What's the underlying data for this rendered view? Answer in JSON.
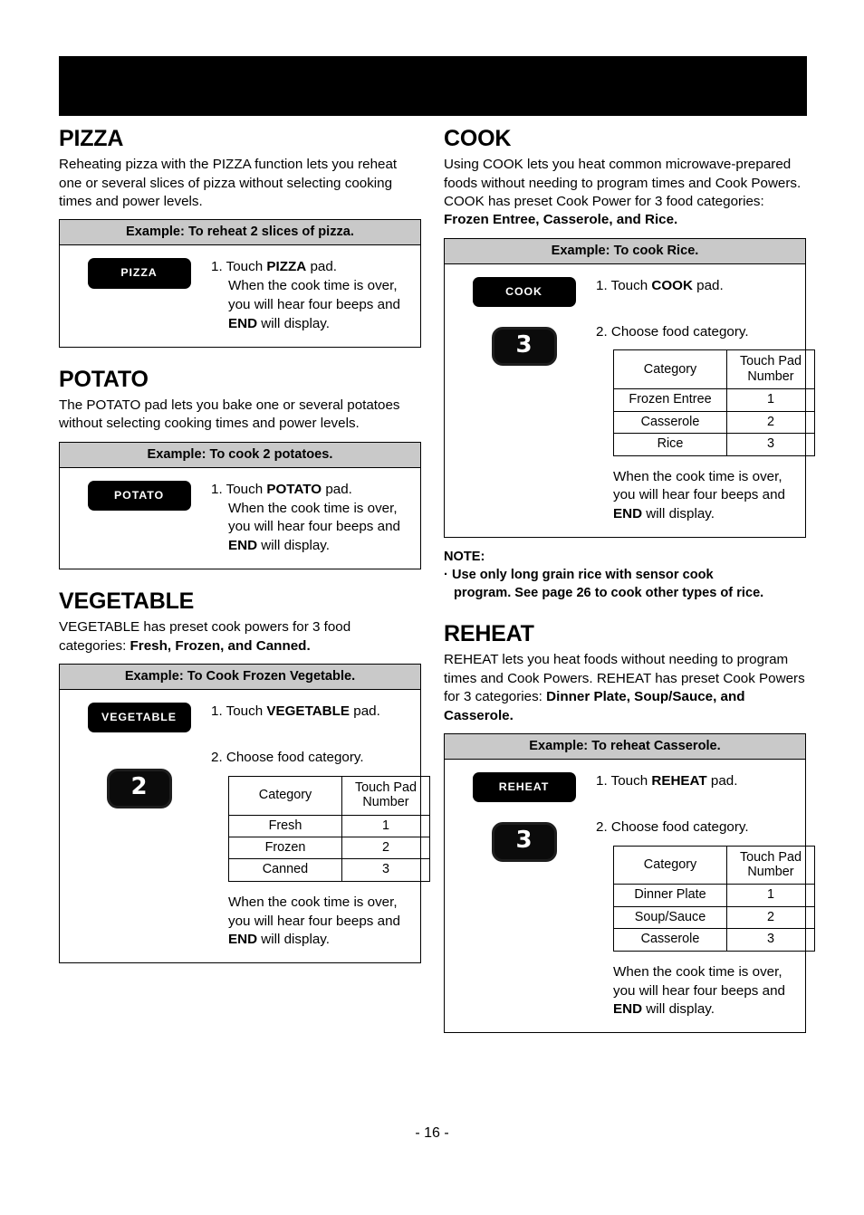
{
  "page": {
    "number_label": "- 16 -",
    "banner_color": "#000000",
    "header_fill": "#c9c9c9"
  },
  "left_column": {
    "pizza": {
      "title": "PIZZA",
      "body": "Reheating pizza with the PIZZA function lets you reheat one or several slices of pizza without selecting cooking times and power levels.",
      "example_header": "Example: To reheat 2 slices of pizza.",
      "pad_label": "PIZZA",
      "step1_prefix": "1. Touch ",
      "step1_strong": "PIZZA",
      "step1_suffix": " pad.",
      "step1_line2": "When the cook time is over,",
      "step1_line3": "you will hear four beeps and",
      "step1_line4_strong": "END",
      "step1_line4_suffix": " will display."
    },
    "potato": {
      "title": "POTATO",
      "body": "The POTATO pad lets you bake one or several potatoes without selecting cooking times and power levels.",
      "example_header": "Example: To cook 2 potatoes.",
      "pad_label": "POTATO",
      "step1_prefix": "1. Touch ",
      "step1_strong": "POTATO",
      "step1_suffix": " pad.",
      "step1_line2": "When the cook time is over,",
      "step1_line3": "you will hear four beeps and",
      "step1_line4_strong": "END",
      "step1_line4_suffix": " will display."
    },
    "vegetable": {
      "title": "VEGETABLE",
      "body_plain": "VEGETABLE has preset cook powers for 3 food categories: ",
      "body_strong": "Fresh, Frozen, and Canned.",
      "example_header": "Example: To Cook Frozen Vegetable.",
      "pad_label": "VEGETABLE",
      "numpad_label": "2",
      "step1_prefix": "1. Touch ",
      "step1_strong": "VEGETABLE",
      "step1_suffix": " pad.",
      "step2": "2. Choose food category.",
      "table": {
        "header": [
          "Category",
          "Touch Pad Number"
        ],
        "header_col2_line1": "Touch Pad",
        "header_col2_line2": "Number",
        "rows": [
          [
            "Fresh",
            "1"
          ],
          [
            "Frozen",
            "2"
          ],
          [
            "Canned",
            "3"
          ]
        ]
      },
      "closing_line1": "When the cook time is over,",
      "closing_line2": "you will hear four beeps and",
      "closing_line3_strong": "END",
      "closing_line3_suffix": " will display."
    }
  },
  "right_column": {
    "cook": {
      "title": "COOK",
      "body_plain": "Using COOK lets you heat common microwave-prepared foods without needing to program times and Cook Powers. COOK has preset Cook Power for 3 food categories: ",
      "body_strong": "Frozen Entree, Casserole, and Rice.",
      "example_header": "Example: To cook Rice.",
      "pad_label": "COOK",
      "numpad_label": "3",
      "step1_prefix": "1. Touch ",
      "step1_strong": "COOK",
      "step1_suffix": " pad.",
      "step2": "2. Choose food category.",
      "table": {
        "header": [
          "Category",
          "Touch Pad Number"
        ],
        "header_col2_line1": "Touch Pad",
        "header_col2_line2": "Number",
        "rows": [
          [
            "Frozen Entree",
            "1"
          ],
          [
            "Casserole",
            "2"
          ],
          [
            "Rice",
            "3"
          ]
        ]
      },
      "closing_line1": "When the cook time is over,",
      "closing_line2": "you will hear four beeps and",
      "closing_line3_strong": "END",
      "closing_line3_suffix": " will display."
    },
    "note": {
      "title": "NOTE:",
      "bullet": "·",
      "line1": "Use only long grain rice with sensor cook",
      "line2": "program. See page 26 to cook other types of rice."
    },
    "reheat": {
      "title": "REHEAT",
      "body_plain": "REHEAT lets you heat foods without needing to program times and Cook Powers. REHEAT has preset Cook Powers for 3 categories: ",
      "body_strong": "Dinner Plate, Soup/Sauce, and Casserole.",
      "example_header": "Example: To reheat Casserole.",
      "pad_label": "REHEAT",
      "numpad_label": "3",
      "step1_prefix": "1. Touch ",
      "step1_strong": "REHEAT",
      "step1_suffix": " pad.",
      "step2": "2. Choose food category.",
      "table": {
        "header": [
          "Category",
          "Touch Pad Number"
        ],
        "header_col2_line1": "Touch Pad",
        "header_col2_line2": "Number",
        "rows": [
          [
            "Dinner Plate",
            "1"
          ],
          [
            "Soup/Sauce",
            "2"
          ],
          [
            "Casserole",
            "3"
          ]
        ]
      },
      "closing_line1": "When the cook time is over,",
      "closing_line2": "you will hear four beeps and",
      "closing_line3_strong": "END",
      "closing_line3_suffix": " will display."
    }
  }
}
